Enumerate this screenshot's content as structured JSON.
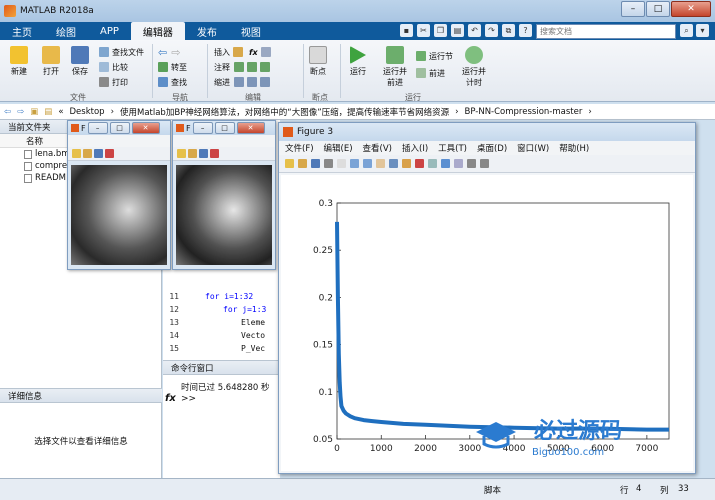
{
  "window": {
    "title": "MATLAB R2018a",
    "minimize": "–",
    "maximize": "□",
    "close": "✕"
  },
  "tabs": [
    "主页",
    "绘图",
    "APP",
    "编辑器",
    "发布",
    "视图"
  ],
  "search_placeholder": "搜索文档",
  "ribbon": {
    "file": {
      "new": "新建",
      "open": "打开",
      "save": "保存",
      "find_files": "查找文件",
      "compare": "比较",
      "print": "打印",
      "group": "文件"
    },
    "nav": {
      "goto": "转至",
      "find": "查找",
      "group": "导航"
    },
    "edit": {
      "insert": "插入",
      "comment": "注释",
      "indent": "缩进",
      "fx": "fx",
      "group": "编辑"
    },
    "breakpoints": {
      "label": "断点",
      "group": "断点"
    },
    "run": {
      "run": "运行",
      "run_advance": "运行并\n前进",
      "run_section": "运行节",
      "advance": "前进",
      "run_time": "运行并\n计时",
      "group": "运行"
    }
  },
  "address": {
    "prefix": "«",
    "path": [
      "Desktop",
      "使用Matlab加BP神经网络算法，对网络中的“大图像”压缩，提高传输速率节省网络资源",
      "BP-NN-Compression-master"
    ]
  },
  "left_pane": {
    "header": "当前文件夹",
    "column": "名称",
    "files": [
      "lena.bm",
      "compre",
      "READM"
    ],
    "details_header": "详细信息",
    "details_msg": "选择文件以查看详细信息"
  },
  "editor": {
    "lines": [
      {
        "num": "11",
        "code": "for i=1:32",
        "kw": true
      },
      {
        "num": "12",
        "code": "for j=1:3",
        "kw": true
      },
      {
        "num": "13",
        "code": "Eleme",
        "kw": false
      },
      {
        "num": "14",
        "code": "Vecto",
        "kw": false
      },
      {
        "num": "15",
        "code": "P_Vec",
        "kw": false
      }
    ]
  },
  "command_window": {
    "header": "命令行窗口",
    "output": "时间已过 5.648280 秒",
    "prompt": ">>",
    "fx": "fx"
  },
  "status": {
    "script": "脚本",
    "row_label": "行",
    "row": "4",
    "col_label": "列",
    "col": "33"
  },
  "figure_small_1": {
    "title": "F"
  },
  "figure_small_2": {
    "title": "F"
  },
  "figure3": {
    "title": "Figure 3",
    "menus": [
      "文件(F)",
      "编辑(E)",
      "查看(V)",
      "插入(I)",
      "工具(T)",
      "桌面(D)",
      "窗口(W)",
      "帮助(H)"
    ]
  },
  "watermark": {
    "text": "必过源码",
    "sub": "Biguo100.com"
  },
  "chart_data": {
    "type": "line",
    "title": "",
    "xlabel": "",
    "ylabel": "",
    "xlim": [
      0,
      7500
    ],
    "ylim": [
      0.05,
      0.3
    ],
    "x_ticks": [
      0,
      1000,
      2000,
      3000,
      4000,
      5000,
      6000,
      7000
    ],
    "y_ticks": [
      0.05,
      0.1,
      0.15,
      0.2,
      0.25,
      0.3
    ],
    "color": "#1f6fbf",
    "series": [
      {
        "x": [
          1,
          20,
          40,
          60,
          80,
          100,
          150,
          200,
          300,
          400,
          600,
          800,
          1000,
          1500,
          2000,
          3000,
          4000,
          5000,
          6000,
          7000,
          7500
        ],
        "y": [
          0.28,
          0.2,
          0.14,
          0.11,
          0.095,
          0.085,
          0.08,
          0.077,
          0.074,
          0.072,
          0.07,
          0.069,
          0.068,
          0.066,
          0.065,
          0.063,
          0.062,
          0.061,
          0.061,
          0.06,
          0.06
        ]
      }
    ]
  }
}
